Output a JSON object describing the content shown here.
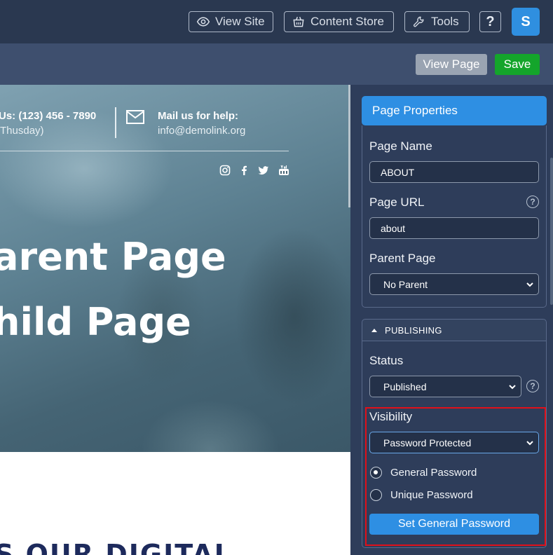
{
  "topbar": {
    "view_site": "View Site",
    "content_store": "Content Store",
    "tools": "Tools",
    "help": "?",
    "avatar_initial": "S"
  },
  "actions": {
    "view_page": "View Page",
    "save": "Save"
  },
  "preview": {
    "call_line1": "Us: (123) 456 - 7890",
    "call_line2": "Thusday)",
    "mail_title": "Mail us for help:",
    "mail_address": "info@demolink.org",
    "hero_line1": "arent Page",
    "hero_line2": "hild Page",
    "bottom_heading": "S OUR DIGITAL"
  },
  "page_properties": {
    "header": "Page Properties",
    "page_name_label": "Page Name",
    "page_name_value": "ABOUT",
    "page_url_label": "Page URL",
    "page_url_value": "about",
    "parent_page_label": "Parent Page",
    "parent_page_value": "No Parent"
  },
  "publishing": {
    "header": "PUBLISHING",
    "status_label": "Status",
    "status_value": "Published",
    "visibility_label": "Visibility",
    "visibility_value": "Password Protected",
    "radio_general": "General Password",
    "radio_unique": "Unique Password",
    "selected_radio": "General Password",
    "set_password_button": "Set General Password"
  },
  "colors": {
    "accent": "#2e8fe3",
    "save": "#14a52b",
    "highlight": "#e0101a"
  }
}
